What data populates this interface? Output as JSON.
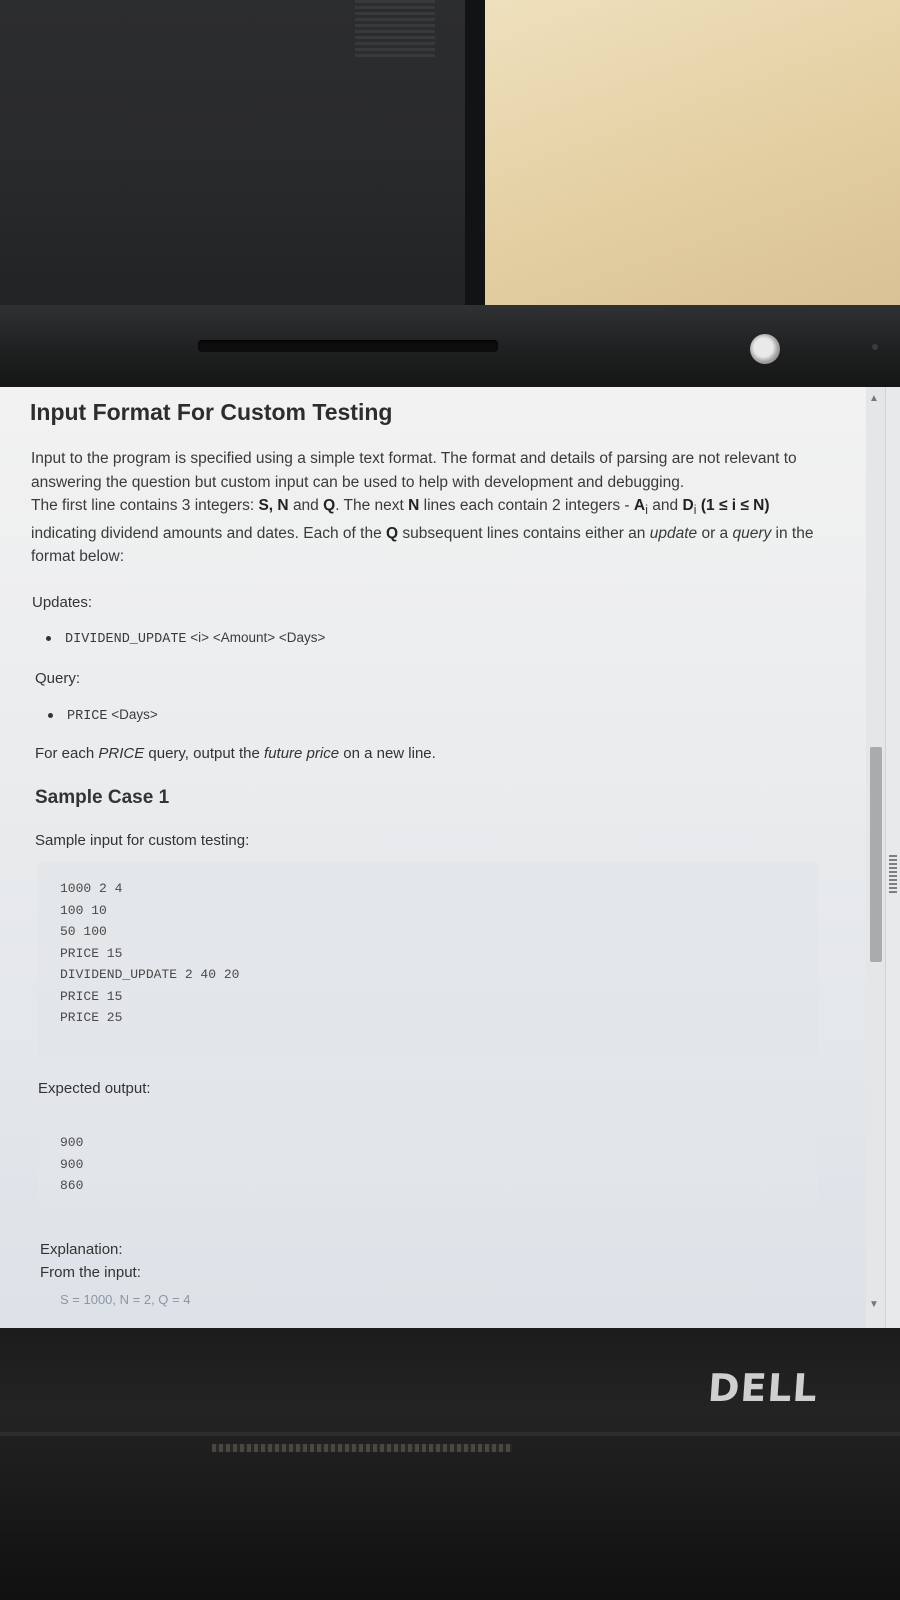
{
  "screen": {
    "heading": "Input Format For Custom Testing",
    "intro_part1": "Input to the program is specified using a simple text format. The format and details of parsing are not relevant to answering the question but custom input can be used to help with development and debugging.",
    "intro_part2_prefix": "The first line contains 3 integers: ",
    "var_s": "S",
    "var_n": "N",
    "and_word": "and",
    "var_q": "Q",
    "intro_part2_mid": ". The next ",
    "intro_part2_mid2": " lines each contain 2 integers - ",
    "var_ai": "A",
    "var_di": "D",
    "sub_i": "i",
    "intro_range": "(1 ≤ i ≤ N)",
    "intro_part3": " indicating dividend amounts and dates. Each of the ",
    "intro_part4_a": " subsequent lines contains either an ",
    "update_word": "update",
    "or_a": " or a ",
    "query_word": "query",
    "intro_part4_b": " in the format below:",
    "updates_label": "Updates:",
    "dividend_cmd": "DIVIDEND_UPDATE",
    "dividend_args": "<i> <Amount> <Days>",
    "query_label": "Query:",
    "price_cmd": "PRICE",
    "price_args": "<Days>",
    "price_note_a": "For each ",
    "price_word": "PRICE",
    "price_note_b": " query, output the ",
    "future_price": "future price",
    "price_note_c": " on a new line.",
    "sample_heading": "Sample Case 1",
    "sample_input_label": "Sample input for custom testing:",
    "sample_input_lines": [
      "1000 2 4",
      "100 10",
      "50 100",
      "PRICE 15",
      "DIVIDEND_UPDATE 2 40 20",
      "PRICE 15",
      "PRICE 25"
    ],
    "expected_label": "Expected output:",
    "expected_output_lines": [
      "900",
      "900",
      "860"
    ],
    "explanation_label": "Explanation:",
    "from_input_label": "From the input:",
    "cut_line": "S = 1000, N = 2, Q = 4"
  },
  "bezel": {
    "brand": "DELL"
  },
  "colors": {
    "heading": "#2d2d2d",
    "body_text": "#333333",
    "code_text": "#4a4a4a",
    "screen_bg": "#eceef0"
  },
  "icons": [
    "scroll-up-arrow-icon",
    "scroll-down-arrow-icon",
    "resize-grip-icon",
    "webcam-icon"
  ]
}
